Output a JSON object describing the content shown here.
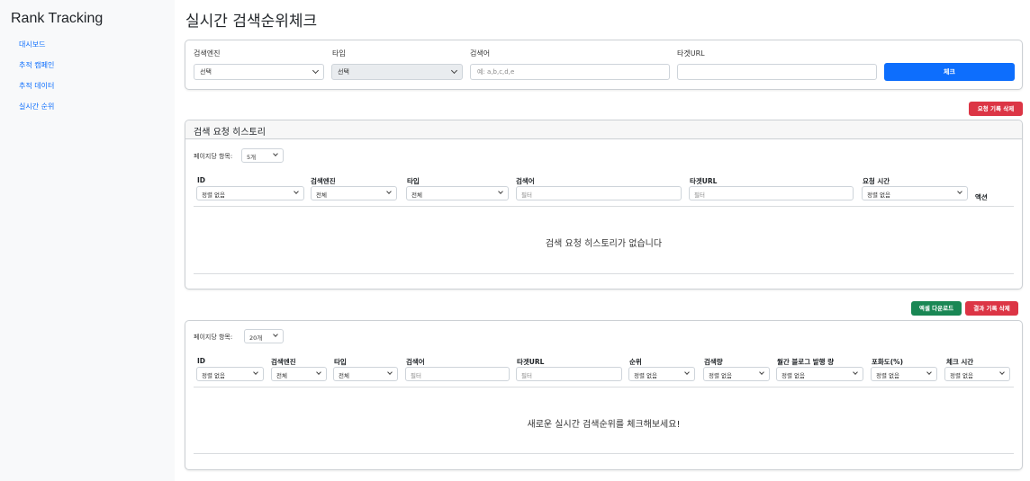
{
  "sidebar": {
    "brand": "Rank Tracking",
    "items": [
      {
        "label": "대시보드"
      },
      {
        "label": "추적 캠페인"
      },
      {
        "label": "추적 데이터"
      },
      {
        "label": "실시간 순위"
      }
    ]
  },
  "page": {
    "title": "실시간 검색순위체크"
  },
  "check_form": {
    "engine_label": "검색엔진",
    "engine_value": "선택",
    "type_label": "타입",
    "type_value": "선택",
    "keyword_label": "검색어",
    "keyword_placeholder": "예: a,b,c,d,e",
    "url_label": "타겟URL",
    "url_value": "",
    "submit_label": "체크"
  },
  "history": {
    "delete_label": "요청 기록 삭제",
    "title": "검색 요청 히스토리",
    "per_page_label": "페이지당 항목:",
    "per_page_value": "5개",
    "columns": {
      "id": "ID",
      "engine": "검색엔진",
      "type": "타입",
      "keyword": "검색어",
      "url": "타겟URL",
      "time": "요청 시간",
      "action": "액션"
    },
    "filters": {
      "id": "정렬 없음",
      "engine": "전체",
      "type": "전체",
      "keyword_placeholder": "필터",
      "url_placeholder": "필터",
      "time": "정렬 없음"
    },
    "empty_text": "검색 요청 히스토리가 없습니다"
  },
  "results": {
    "excel_label": "엑셀 다운로드",
    "delete_label": "결과 기록 삭제",
    "per_page_label": "페이지당 항목:",
    "per_page_value": "20개",
    "columns": {
      "id": "ID",
      "engine": "검색엔진",
      "type": "타입",
      "keyword": "검색어",
      "url": "타겟URL",
      "rank": "순위",
      "volume": "검색량",
      "blog": "월간 블로그 발행 량",
      "saturation": "포화도(%)",
      "time": "체크 시간"
    },
    "filters": {
      "id": "정렬 없음",
      "engine": "전체",
      "type": "전체",
      "keyword_placeholder": "필터",
      "url_placeholder": "필터",
      "rank": "정렬 없음",
      "volume": "정렬 없음",
      "blog": "정렬 없음",
      "saturation": "정렬 없음",
      "time": "정렬 없음"
    },
    "empty_text": "새로운 실시간 검색순위를 체크해보세요!"
  },
  "colors": {
    "primary": "#0d6efd",
    "danger": "#dc3545",
    "success": "#198754",
    "link": "#0d6efd"
  }
}
